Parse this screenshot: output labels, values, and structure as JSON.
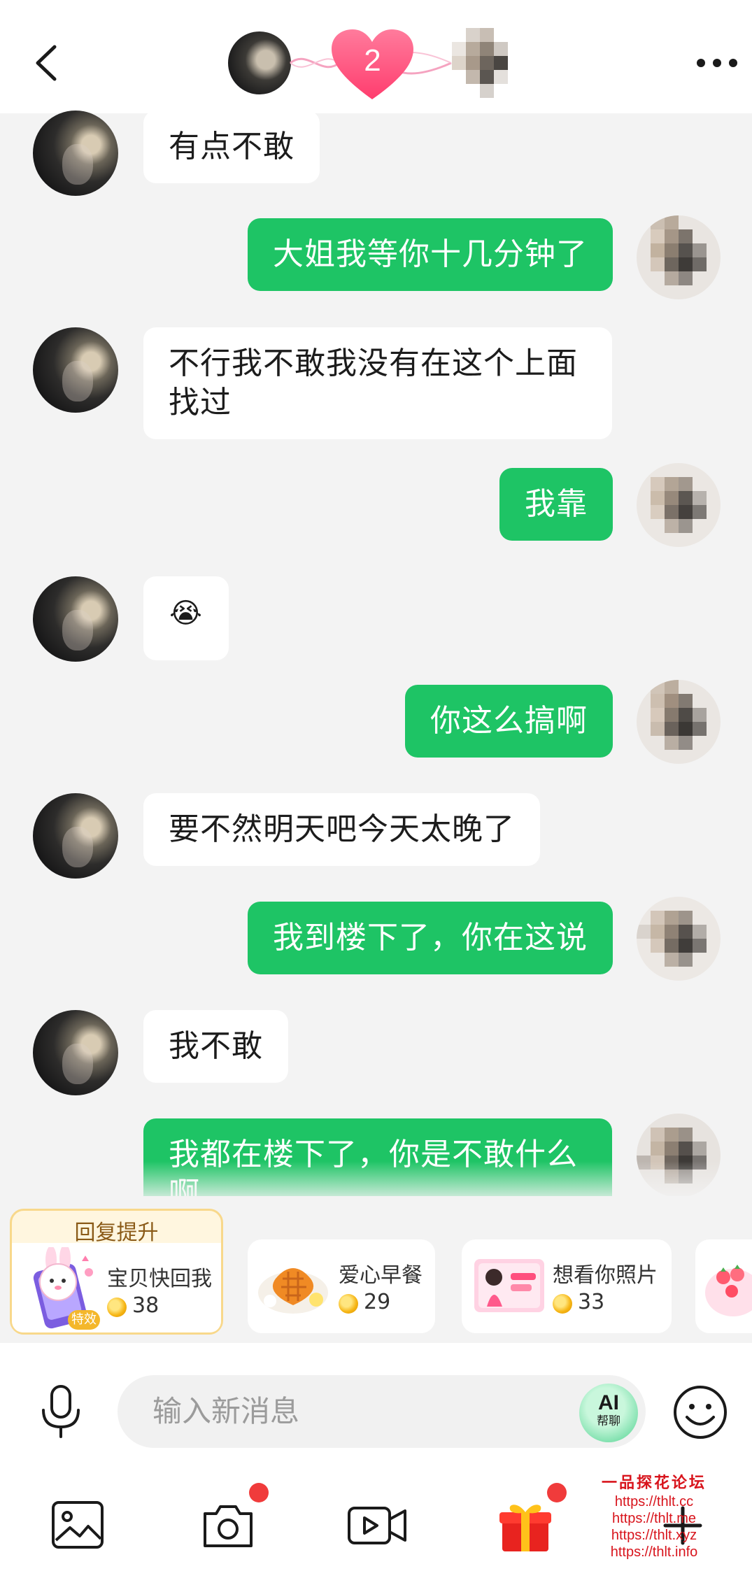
{
  "header": {
    "intimacy_level": "2"
  },
  "messages": [
    {
      "from": "her",
      "text": "有点不敢"
    },
    {
      "from": "me",
      "text": "大姐我等你十几分钟了"
    },
    {
      "from": "her",
      "text": "不行我不敢我没有在这个上面找过"
    },
    {
      "from": "me",
      "text": "我靠"
    },
    {
      "from": "her",
      "text": "😭"
    },
    {
      "from": "me",
      "text": "你这么搞啊"
    },
    {
      "from": "her",
      "text": "要不然明天吧今天太晚了"
    },
    {
      "from": "me",
      "text": "我到楼下了，你在这说"
    },
    {
      "from": "her",
      "text": "我不敢"
    },
    {
      "from": "me",
      "text": "我都在楼下了，你是不敢什么啊"
    }
  ],
  "quick_replies": {
    "header_label": "回复提升",
    "special_badge": "特效",
    "items": [
      {
        "title": "宝贝快回我",
        "price": "38"
      },
      {
        "title": "爱心早餐",
        "price": "29"
      },
      {
        "title": "想看你照片",
        "price": "33"
      }
    ]
  },
  "input": {
    "placeholder": "输入新消息",
    "ai_label": "AI",
    "ai_sublabel": "帮聊"
  },
  "icons": {
    "back": "chevron-left-icon",
    "more": "more-dots-icon",
    "mic": "microphone-icon",
    "emoji": "smiley-icon",
    "image": "image-icon",
    "camera": "camera-icon",
    "video": "video-icon",
    "gift": "gift-icon",
    "add": "plus-icon"
  },
  "watermark": {
    "title": "一品探花论坛",
    "urls": [
      "https://thlt.cc",
      "https://thlt.me",
      "https://thlt.xyz",
      "https://thlt.info"
    ]
  },
  "colors": {
    "outgoing_bubble": "#1ec465",
    "incoming_bubble": "#ffffff",
    "background": "#f3f3f3",
    "heart": "#ff4f7e",
    "notification_dot": "#f03b3b"
  }
}
